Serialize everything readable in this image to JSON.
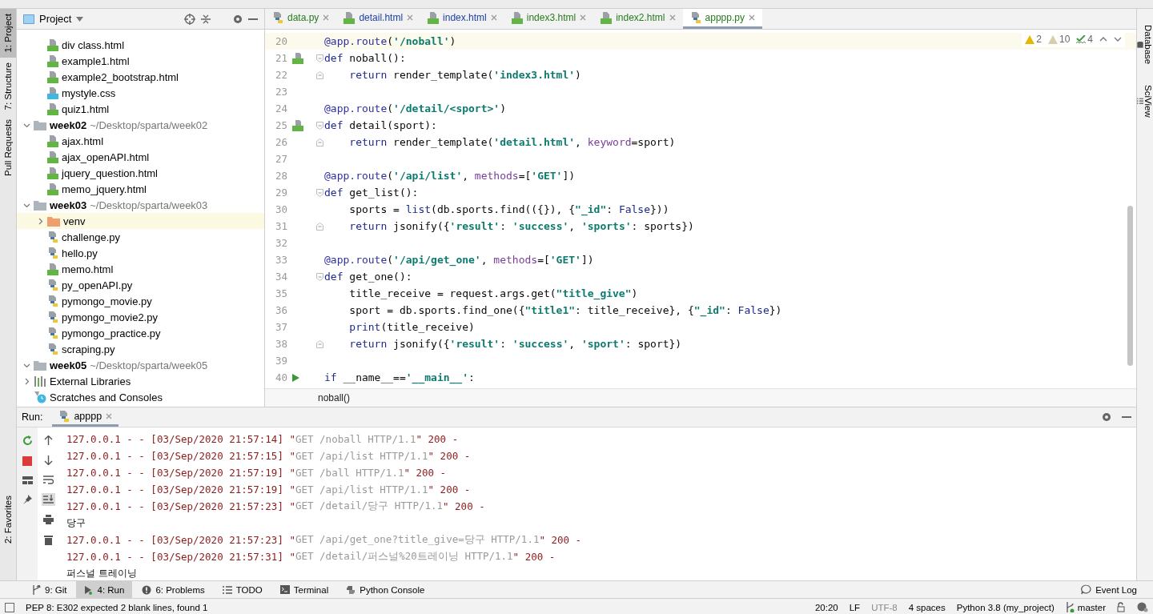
{
  "left_stripe": [
    {
      "label": "1: Project",
      "selected": true
    },
    {
      "label": "7: Structure",
      "selected": false
    },
    {
      "label": "Pull Requests",
      "selected": false
    },
    {
      "label": "2: Favorites",
      "selected": false
    }
  ],
  "project_panel": {
    "title": "Project",
    "tree": [
      {
        "kind": "folder",
        "children": [
          {
            "kind": "html",
            "label": "div class.html"
          },
          {
            "kind": "html",
            "label": "example1.html"
          },
          {
            "kind": "html",
            "label": "example2_bootstrap.html"
          },
          {
            "kind": "css",
            "label": "mystyle.css"
          },
          {
            "kind": "html",
            "label": "quiz1.html"
          }
        ]
      },
      {
        "kind": "folder",
        "label": "week02",
        "path": "~/Desktop/sparta/week02",
        "expanded": true,
        "children": [
          {
            "kind": "html",
            "label": "ajax.html"
          },
          {
            "kind": "html",
            "label": "ajax_openAPI.html"
          },
          {
            "kind": "html",
            "label": "jquery_question.html"
          },
          {
            "kind": "html",
            "label": "memo_jquery.html"
          }
        ]
      },
      {
        "kind": "folder",
        "label": "week03",
        "path": "~/Desktop/sparta/week03",
        "expanded": true,
        "children": [
          {
            "kind": "venv",
            "label": "venv",
            "expanded": false,
            "selected": true
          },
          {
            "kind": "py",
            "label": "challenge.py",
            "selected": false
          },
          {
            "kind": "py",
            "label": "hello.py",
            "selected": false
          },
          {
            "kind": "html",
            "label": "memo.html",
            "selected": false
          },
          {
            "kind": "py",
            "label": "py_openAPI.py",
            "selected": false
          },
          {
            "kind": "py",
            "label": "pymongo_movie.py",
            "selected": false
          },
          {
            "kind": "py",
            "label": "pymongo_movie2.py",
            "selected": false
          },
          {
            "kind": "py",
            "label": "pymongo_practice.py",
            "selected": false
          },
          {
            "kind": "py",
            "label": "scraping.py",
            "selected": false
          }
        ]
      },
      {
        "kind": "folder",
        "label": "week05",
        "path": "~/Desktop/sparta/week05",
        "expanded": true
      },
      {
        "kind": "libs",
        "label": "External Libraries",
        "expanded": false
      },
      {
        "kind": "scratch",
        "label": "Scratches and Consoles"
      }
    ]
  },
  "editor_tabs": [
    {
      "kind": "py",
      "label": "data.py",
      "color": "#287b1f",
      "selected": false
    },
    {
      "kind": "html",
      "label": "detail.html",
      "color": "#1d3fa8",
      "selected": false
    },
    {
      "kind": "html",
      "label": "index.html",
      "color": "#1d3fa8",
      "selected": false
    },
    {
      "kind": "html",
      "label": "index3.html",
      "color": "#287b1f",
      "selected": false
    },
    {
      "kind": "html",
      "label": "index2.html",
      "color": "#287b1f",
      "selected": false
    },
    {
      "kind": "py",
      "label": "apppp.py",
      "color": "#287b1f",
      "selected": true
    }
  ],
  "inspections": {
    "warnings": "2",
    "weak_warnings": "10",
    "typos": "4"
  },
  "code_lines": [
    {
      "number": "20",
      "current": true,
      "tokens": [
        {
          "kind": "deco",
          "text": "@app.route"
        },
        {
          "kind": "p",
          "text": "("
        },
        {
          "kind": "str",
          "text": "'/noball'"
        },
        {
          "kind": "p",
          "text": ")"
        }
      ]
    },
    {
      "number": "21",
      "html_marker": true,
      "fold_start": true,
      "tokens": [
        {
          "kind": "kw",
          "text": "def"
        },
        {
          "kind": "p",
          "text": " noball():"
        }
      ]
    },
    {
      "number": "22",
      "fold_end": true,
      "tokens": [
        {
          "kind": "kw",
          "text": "    return"
        },
        {
          "kind": "p",
          "text": " render_template("
        },
        {
          "kind": "str",
          "text": "'index3.html'"
        },
        {
          "kind": "p",
          "text": ")"
        }
      ]
    },
    {
      "number": "23"
    },
    {
      "number": "24",
      "tokens": [
        {
          "kind": "deco",
          "text": "@app.route"
        },
        {
          "kind": "p",
          "text": "("
        },
        {
          "kind": "str",
          "text": "'/detail/<sport>'"
        },
        {
          "kind": "p",
          "text": ")"
        }
      ]
    },
    {
      "number": "25",
      "html_marker": true,
      "fold_start": true,
      "tokens": [
        {
          "kind": "kw",
          "text": "def"
        },
        {
          "kind": "p",
          "text": " detail(sport):"
        }
      ]
    },
    {
      "number": "26",
      "fold_end": true,
      "tokens": [
        {
          "kind": "kw",
          "text": "    return"
        },
        {
          "kind": "p",
          "text": " render_template("
        },
        {
          "kind": "str",
          "text": "'detail.html'"
        },
        {
          "kind": "p",
          "text": ", "
        },
        {
          "kind": "kwarg",
          "text": "keyword"
        },
        {
          "kind": "p",
          "text": "=sport)"
        }
      ]
    },
    {
      "number": "27"
    },
    {
      "number": "28",
      "tokens": [
        {
          "kind": "deco",
          "text": "@app.route"
        },
        {
          "kind": "p",
          "text": "("
        },
        {
          "kind": "str",
          "text": "'/api/list'"
        },
        {
          "kind": "p",
          "text": ", "
        },
        {
          "kind": "kwarg",
          "text": "methods"
        },
        {
          "kind": "p",
          "text": "=["
        },
        {
          "kind": "str",
          "text": "'GET'"
        },
        {
          "kind": "p",
          "text": "])"
        }
      ]
    },
    {
      "number": "29",
      "fold_start": true,
      "tokens": [
        {
          "kind": "kw",
          "text": "def"
        },
        {
          "kind": "p",
          "text": " get_list():"
        }
      ]
    },
    {
      "number": "30",
      "tokens": [
        {
          "kind": "p",
          "text": "    sports = "
        },
        {
          "kind": "kw",
          "text": "list"
        },
        {
          "kind": "p",
          "text": "(db.sports.find(({}), {"
        },
        {
          "kind": "str",
          "text": "\"_id\""
        },
        {
          "kind": "p",
          "text": ": "
        },
        {
          "kind": "kw",
          "text": "False"
        },
        {
          "kind": "p",
          "text": "}))"
        }
      ]
    },
    {
      "number": "31",
      "fold_end": true,
      "tokens": [
        {
          "kind": "kw",
          "text": "    return"
        },
        {
          "kind": "p",
          "text": " jsonify({"
        },
        {
          "kind": "str",
          "text": "'result'"
        },
        {
          "kind": "p",
          "text": ": "
        },
        {
          "kind": "str",
          "text": "'success'"
        },
        {
          "kind": "p",
          "text": ", "
        },
        {
          "kind": "str",
          "text": "'sports'"
        },
        {
          "kind": "p",
          "text": ": sports})"
        }
      ]
    },
    {
      "number": "32"
    },
    {
      "number": "33",
      "tokens": [
        {
          "kind": "deco",
          "text": "@app.route"
        },
        {
          "kind": "p",
          "text": "("
        },
        {
          "kind": "str",
          "text": "'/api/get_one'"
        },
        {
          "kind": "p",
          "text": ", "
        },
        {
          "kind": "kwarg",
          "text": "methods"
        },
        {
          "kind": "p",
          "text": "=["
        },
        {
          "kind": "str",
          "text": "'GET'"
        },
        {
          "kind": "p",
          "text": "])"
        }
      ]
    },
    {
      "number": "34",
      "fold_start": true,
      "tokens": [
        {
          "kind": "kw",
          "text": "def"
        },
        {
          "kind": "p",
          "text": " get_one():"
        }
      ]
    },
    {
      "number": "35",
      "tokens": [
        {
          "kind": "p",
          "text": "    title_receive = request.args.get("
        },
        {
          "kind": "str",
          "text": "\"title_give\""
        },
        {
          "kind": "p",
          "text": ")"
        }
      ]
    },
    {
      "number": "36",
      "tokens": [
        {
          "kind": "p",
          "text": "    sport = db.sports.find_one({"
        },
        {
          "kind": "str",
          "text": "\"title1\""
        },
        {
          "kind": "p",
          "text": ": title_receive}, {"
        },
        {
          "kind": "str",
          "text": "\"_id\""
        },
        {
          "kind": "p",
          "text": ": "
        },
        {
          "kind": "kw",
          "text": "False"
        },
        {
          "kind": "p",
          "text": "})"
        }
      ]
    },
    {
      "number": "37",
      "tokens": [
        {
          "kind": "kw",
          "text": "    print"
        },
        {
          "kind": "p",
          "text": "(title_receive)"
        }
      ]
    },
    {
      "number": "38",
      "fold_end": true,
      "tokens": [
        {
          "kind": "kw",
          "text": "    return"
        },
        {
          "kind": "p",
          "text": " jsonify({"
        },
        {
          "kind": "str",
          "text": "'result'"
        },
        {
          "kind": "p",
          "text": ": "
        },
        {
          "kind": "str",
          "text": "'success'"
        },
        {
          "kind": "p",
          "text": ", "
        },
        {
          "kind": "str",
          "text": "'sport'"
        },
        {
          "kind": "p",
          "text": ": sport})"
        }
      ]
    },
    {
      "number": "39"
    },
    {
      "number": "40",
      "run_marker": true,
      "tokens": [
        {
          "kind": "kw",
          "text": "if"
        },
        {
          "kind": "p",
          "text": " __name__=="
        },
        {
          "kind": "str",
          "text": "'__main__'"
        },
        {
          "kind": "p",
          "text": ":"
        }
      ]
    }
  ],
  "breadcrumb": "noball()",
  "run_panel": {
    "label": "Run:",
    "tab": "apppp",
    "lines": [
      {
        "kind": "log",
        "prefix": "127.0.0.1 - - [03/Sep/2020 21:57:14] \"",
        "request": "GET /noball HTTP/1.1",
        "suffix": "\" 200 -"
      },
      {
        "kind": "log",
        "prefix": "127.0.0.1 - - [03/Sep/2020 21:57:15] \"",
        "request": "GET /api/list HTTP/1.1",
        "suffix": "\" 200 -"
      },
      {
        "kind": "log",
        "prefix": "127.0.0.1 - - [03/Sep/2020 21:57:19] \"",
        "request": "GET /ball HTTP/1.1",
        "suffix": "\" 200 -"
      },
      {
        "kind": "log",
        "prefix": "127.0.0.1 - - [03/Sep/2020 21:57:19] \"",
        "request": "GET /api/list HTTP/1.1",
        "suffix": "\" 200 -"
      },
      {
        "kind": "log",
        "prefix": "127.0.0.1 - - [03/Sep/2020 21:57:23] \"",
        "request": "GET /detail/당구 HTTP/1.1",
        "suffix": "\" 200 -"
      },
      {
        "kind": "out",
        "text": "당구"
      },
      {
        "kind": "log",
        "prefix": "127.0.0.1 - - [03/Sep/2020 21:57:23] \"",
        "request": "GET /api/get_one?title_give=당구 HTTP/1.1",
        "suffix": "\" 200 -"
      },
      {
        "kind": "log",
        "prefix": "127.0.0.1 - - [03/Sep/2020 21:57:31] \"",
        "request": "GET /detail/퍼스널%20트레이닝 HTTP/1.1",
        "suffix": "\" 200 -"
      },
      {
        "kind": "out",
        "text": "퍼스널 트레이닝"
      }
    ]
  },
  "tool_tabs": [
    {
      "kind": "git",
      "label": "9: Git",
      "selected": false
    },
    {
      "kind": "run",
      "label": "4: Run",
      "selected": true
    },
    {
      "kind": "problems",
      "label": "6: Problems",
      "selected": false
    },
    {
      "kind": "todo",
      "label": "TODO",
      "selected": false
    },
    {
      "kind": "terminal",
      "label": "Terminal",
      "selected": false
    },
    {
      "kind": "console",
      "label": "Python Console",
      "selected": false
    }
  ],
  "event_log": "Event Log",
  "right_stripe": [
    "Database",
    "SciView"
  ],
  "status_bar": {
    "message": "PEP 8: E302 expected 2 blank lines, found 1",
    "position": "20:20",
    "line_sep": "LF",
    "encoding": "UTF-8",
    "indent": "4 spaces",
    "interpreter": "Python 3.8 (my_project)",
    "branch": "master"
  }
}
